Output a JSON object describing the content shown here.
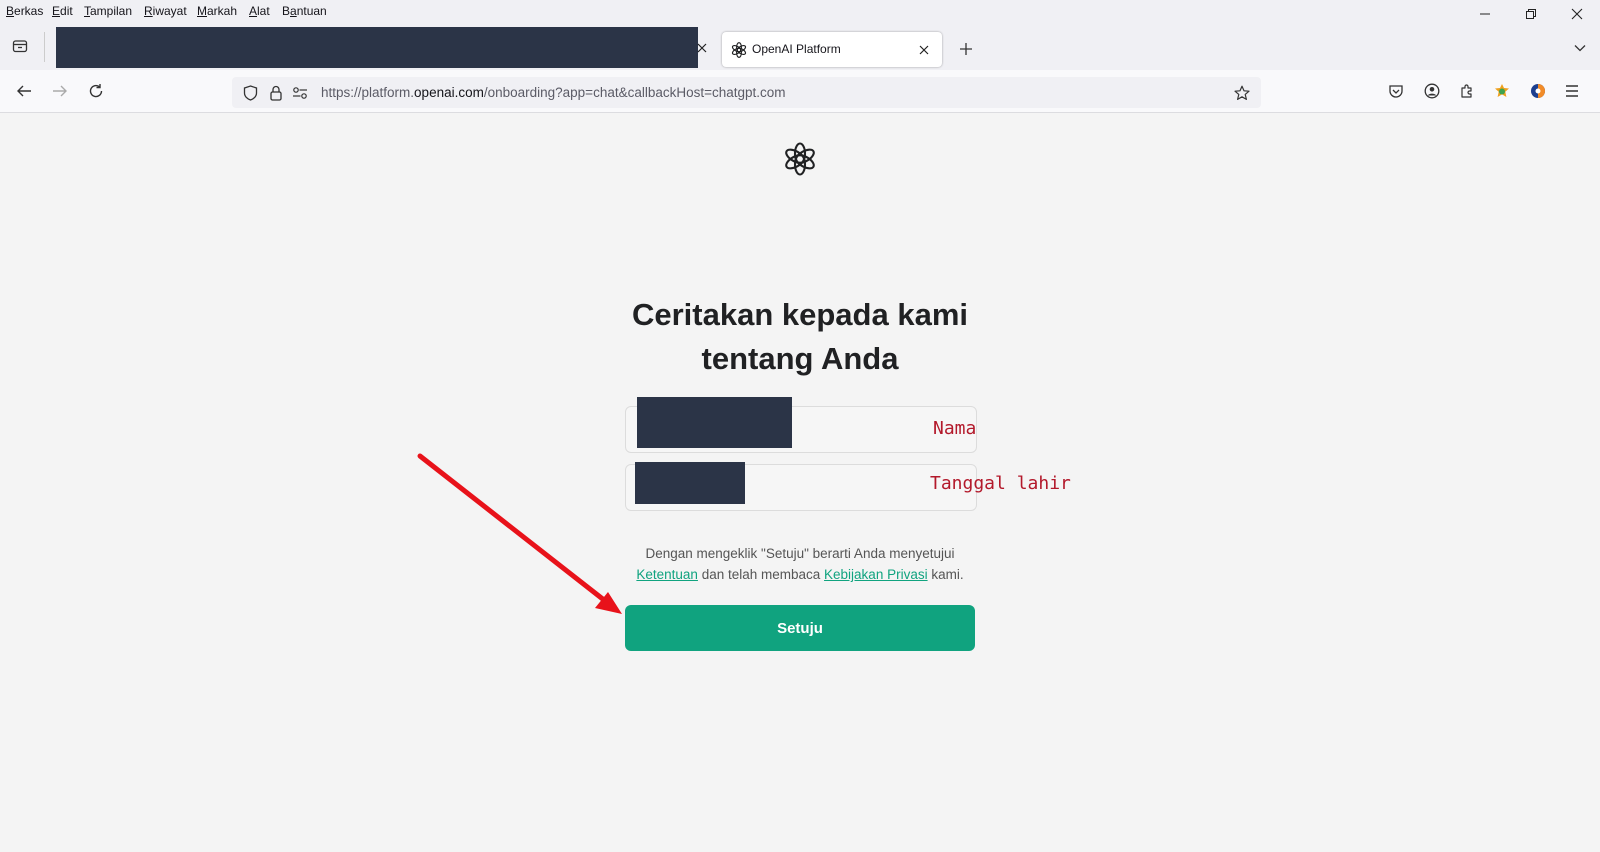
{
  "menubar": {
    "items": [
      {
        "label": "Berkas",
        "accel": "B",
        "rest": "erkas"
      },
      {
        "label": "Edit",
        "accel": "E",
        "rest": "dit"
      },
      {
        "label": "Tampilan",
        "accel": "T",
        "rest": "ampilan"
      },
      {
        "label": "Riwayat",
        "accel": "R",
        "rest": "iwayat"
      },
      {
        "label": "Markah",
        "accel": "M",
        "rest": "arkah"
      },
      {
        "label": "Alat",
        "accel": "A",
        "rest": "lat"
      },
      {
        "label": "Bantuan",
        "accel": "a",
        "prefix": "B",
        "rest": "ntuan"
      }
    ]
  },
  "tabs": {
    "active_title": "OpenAI Platform"
  },
  "navbar": {
    "url_prefix": "https://platform.",
    "url_domain": "openai.com",
    "url_suffix": "/onboarding?app=chat&callbackHost=chatgpt.com"
  },
  "page": {
    "title_line1": "Ceritakan kepada kami",
    "title_line2": "tentang Anda",
    "name_label": "Nama",
    "birthdate_label": "Tanggal lahir",
    "consent_line1": "Dengan mengeklik \"Setuju\" berarti Anda menyetujui",
    "terms_link": "Ketentuan",
    "consent_mid": " dan telah membaca ",
    "privacy_link": "Kebijakan Privasi",
    "consent_end": " kami.",
    "agree_button": "Setuju"
  },
  "colors": {
    "accent_green": "#10a37f",
    "annotation_red": "#b3192b",
    "arrow_red": "#e8121a",
    "redaction": "#2b3447"
  },
  "icons": [
    "tab-overview-icon",
    "openai-favicon-icon",
    "close-icon",
    "plus-icon",
    "chevron-down-icon",
    "back-arrow-icon",
    "forward-arrow-icon",
    "reload-icon",
    "shield-icon",
    "lock-icon",
    "permissions-icon",
    "star-icon",
    "pocket-icon",
    "account-icon",
    "extensions-icon",
    "addon-icon",
    "app-icon",
    "hamburger-menu-icon",
    "openai-logo-icon",
    "minimize-icon",
    "restore-icon",
    "window-close-icon"
  ]
}
